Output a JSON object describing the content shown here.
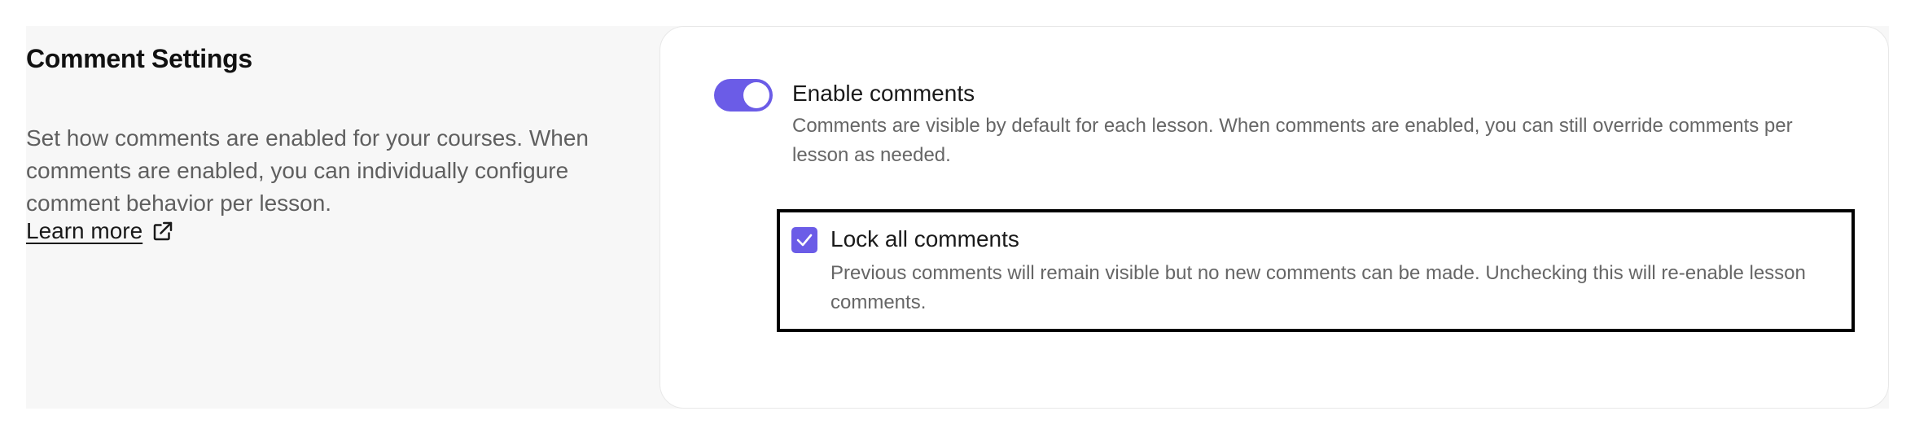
{
  "comment_settings": {
    "title": "Comment Settings",
    "description": "Set how comments are enabled for your courses. When comments are enabled, you can individually configure comment behavior per lesson.",
    "learn_more_label": "Learn more",
    "learn_more_icon": "external-link-icon"
  },
  "enable_comments": {
    "enabled": true,
    "label": "Enable comments",
    "description": "Comments are visible by default for each lesson. When comments are enabled, you can still override comments per lesson as needed."
  },
  "lock_comments": {
    "checked": true,
    "label": "Lock all comments",
    "description": "Previous comments will remain visible but no new comments can be made. Unchecking this will re-enable lesson comments."
  },
  "colors": {
    "accent": "#6b5ce7",
    "panel_background": "#f7f7f7",
    "card_background": "#ffffff",
    "text_primary": "#1a1a1a",
    "text_secondary": "#666666"
  }
}
